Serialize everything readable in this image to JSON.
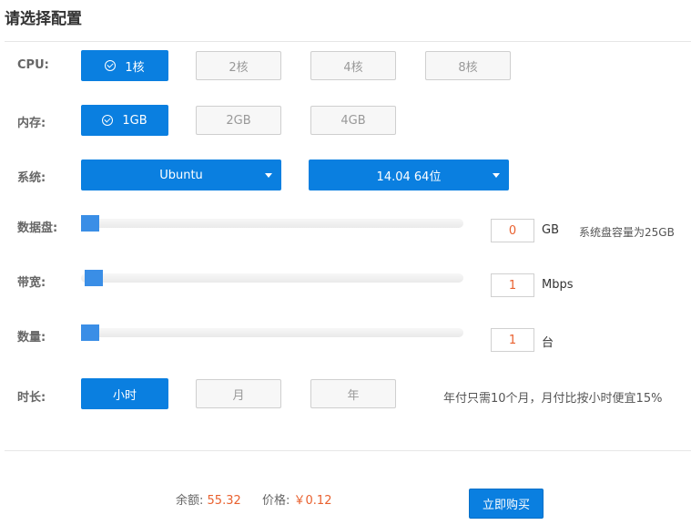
{
  "page_title": "请选择配置",
  "cpu": {
    "label": "CPU:",
    "options": [
      "1核",
      "2核",
      "4核",
      "8核"
    ],
    "selected_index": 0
  },
  "memory": {
    "label": "内存:",
    "options": [
      "1GB",
      "2GB",
      "4GB"
    ],
    "selected_index": 0
  },
  "system": {
    "label": "系统:",
    "os": "Ubuntu",
    "version": "14.04 64位"
  },
  "data_disk": {
    "label": "数据盘:",
    "value": "0",
    "unit": "GB",
    "note": "系统盘容量为25GB"
  },
  "bandwidth": {
    "label": "带宽:",
    "value": "1",
    "unit": "Mbps"
  },
  "quantity": {
    "label": "数量:",
    "value": "1",
    "unit": "台"
  },
  "duration": {
    "label": "时长:",
    "options": [
      "小时",
      "月",
      "年"
    ],
    "selected_index": 0,
    "note": "年付只需10个月，月付比按小时便宜15%"
  },
  "footer": {
    "balance_label": "余额:",
    "balance_value": "55.32",
    "price_label": "价格:",
    "price_value": "￥0.12",
    "buy_label": "立即购买"
  },
  "colors": {
    "primary": "#0a7fe0",
    "accent": "#e9612f",
    "slider": "#3a8ee6"
  }
}
